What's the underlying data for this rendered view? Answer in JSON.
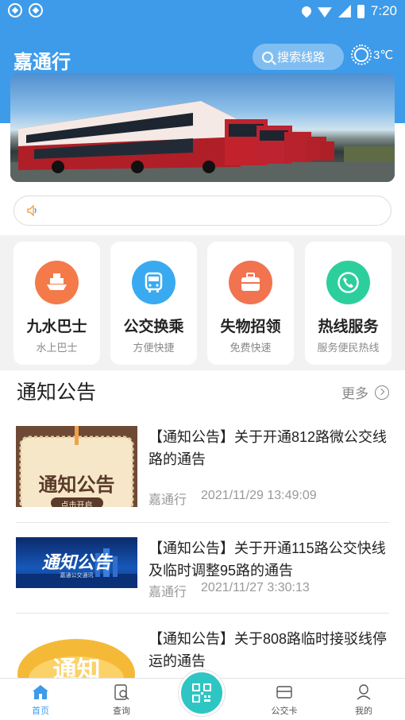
{
  "status_bar": {
    "time": "7:20"
  },
  "header": {
    "app_title": "嘉通行",
    "search_placeholder": "搜索线路",
    "temperature": "3℃"
  },
  "services": [
    {
      "name": "九水巴士",
      "sub": "水上巴士",
      "icon": "ship-icon",
      "color": "#f47a4a"
    },
    {
      "name": "公交换乘",
      "sub": "方便快捷",
      "icon": "bus-icon",
      "color": "#3aaaf0"
    },
    {
      "name": "失物招领",
      "sub": "免费快速",
      "icon": "bag-icon",
      "color": "#f2734f"
    },
    {
      "name": "热线服务",
      "sub": "服务便民热线",
      "icon": "phone-icon",
      "color": "#2ccf9b"
    }
  ],
  "notices_section": {
    "title": "通知公告",
    "more": "更多"
  },
  "news": [
    {
      "title": "【通知公告】关于开通812路微公交线路的通告",
      "source": "嘉通行",
      "time": "2021/11/29 13:49:09",
      "thumb_text": "通知公告",
      "thumb_sub": "点击开启"
    },
    {
      "title": "【通知公告】关于开通115路公交快线及临时调整95路的通告",
      "source": "嘉通行",
      "time": "2021/11/27 3:30:13",
      "thumb_text": "通知公告",
      "thumb_sub": "嘉通公交通讯"
    },
    {
      "title": "【通知公告】关于808路临时接驳线停运的通告",
      "thumb_text": "通知"
    }
  ],
  "tabbar": [
    {
      "label": "首页",
      "icon": "home-icon",
      "active": true
    },
    {
      "label": "查询",
      "icon": "query-icon",
      "active": false
    },
    {
      "label": "公交卡",
      "icon": "card-icon",
      "active": false
    },
    {
      "label": "我的",
      "icon": "user-icon",
      "active": false
    }
  ],
  "colors": {
    "primary": "#3d9bea",
    "scan": "#2ec6c3"
  }
}
